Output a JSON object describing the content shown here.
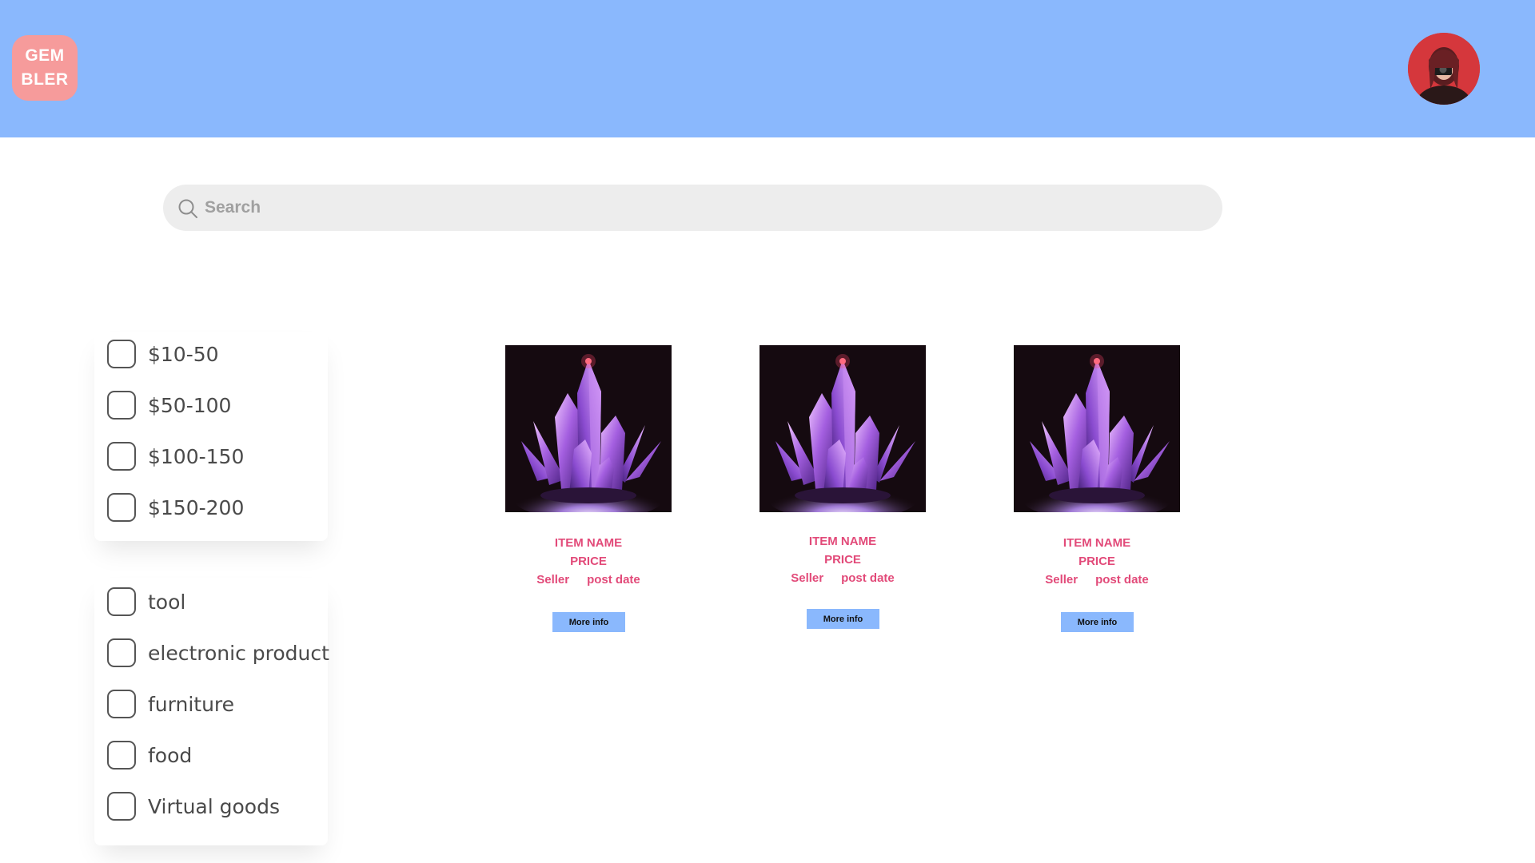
{
  "header": {
    "logo_line1": "GEM",
    "logo_line2": "BLER",
    "color": "#8ab8fd"
  },
  "search": {
    "placeholder": "Search"
  },
  "filters": {
    "price": [
      "$10-50",
      "$50-100",
      "$100-150",
      "$150-200"
    ],
    "category": [
      "tool",
      "electronic product",
      "furniture",
      "food",
      "Virtual goods"
    ]
  },
  "products": [
    {
      "name": "ITEM NAME",
      "price": "PRICE",
      "seller": "Seller",
      "date": "post date",
      "button": "More info"
    },
    {
      "name": "ITEM NAME",
      "price": "PRICE",
      "seller": "Seller",
      "date": "post date",
      "button": "More info"
    },
    {
      "name": "ITEM NAME",
      "price": "PRICE",
      "seller": "Seller",
      "date": "post date",
      "button": "More info"
    }
  ],
  "colors": {
    "accent": "#8ab8fd",
    "logo": "#f69b9b",
    "product_text": "#e24a79"
  },
  "icons": [
    "search-icon",
    "checkbox-icon",
    "crystal-image",
    "avatar-photo"
  ]
}
